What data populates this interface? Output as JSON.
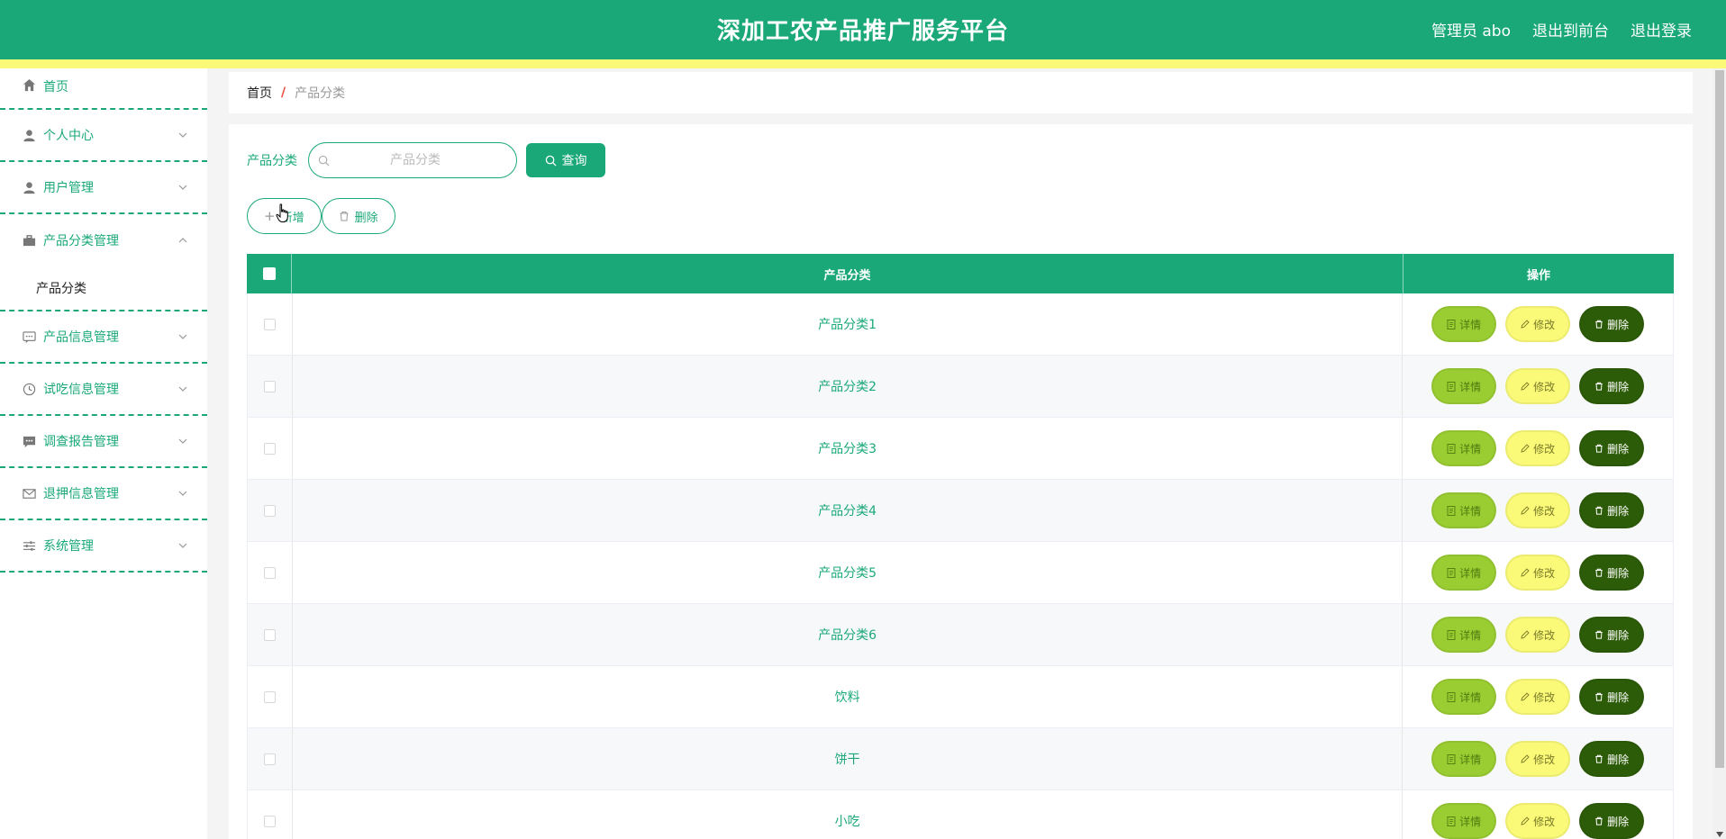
{
  "header": {
    "title": "深加工农产品推广服务平台",
    "admin_label": "管理员 abo",
    "front_label": "退出到前台",
    "logout_label": "退出登录"
  },
  "sidebar": {
    "items": [
      {
        "label": "首页",
        "icon": "home-icon"
      },
      {
        "label": "个人中心",
        "icon": "user-icon"
      },
      {
        "label": "用户管理",
        "icon": "user-icon"
      },
      {
        "label": "产品分类管理",
        "icon": "briefcase-icon"
      },
      {
        "label": "产品信息管理",
        "icon": "chat-icon"
      },
      {
        "label": "试吃信息管理",
        "icon": "clock-icon"
      },
      {
        "label": "调查报告管理",
        "icon": "message-icon"
      },
      {
        "label": "退押信息管理",
        "icon": "mail-icon"
      },
      {
        "label": "系统管理",
        "icon": "sliders-icon"
      }
    ],
    "submenu_label": "产品分类"
  },
  "breadcrumb": {
    "home": "首页",
    "separator": "/",
    "current": "产品分类"
  },
  "search": {
    "label": "产品分类",
    "placeholder": "产品分类",
    "value": "",
    "button_label": "查询"
  },
  "actions": {
    "add_label": "新增",
    "delete_label": "删除"
  },
  "table": {
    "headers": {
      "name": "产品分类",
      "ops": "操作"
    },
    "rows": [
      "产品分类1",
      "产品分类2",
      "产品分类3",
      "产品分类4",
      "产品分类5",
      "产品分类6",
      "饮料",
      "饼干",
      "小吃"
    ],
    "op_labels": {
      "detail": "详情",
      "edit": "修改",
      "delete": "删除"
    }
  },
  "colors": {
    "primary": "#1aa879",
    "accent_yellow": "#fafa78",
    "detail_green": "#9acd32",
    "dark_green": "#2d5c08"
  }
}
